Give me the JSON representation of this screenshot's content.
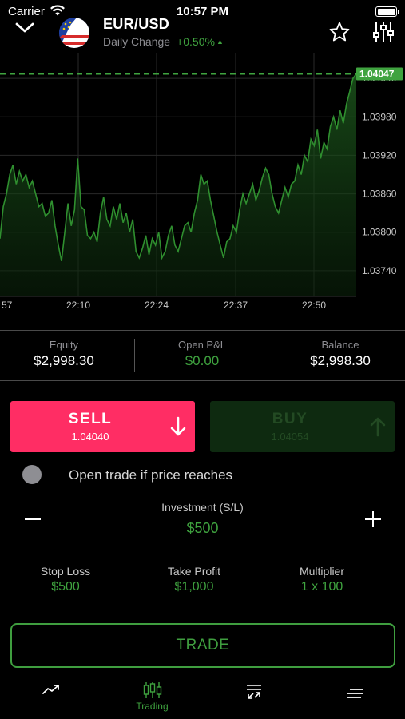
{
  "status_bar": {
    "carrier": "Carrier",
    "time": "10:57 PM"
  },
  "header": {
    "pair": "EUR/USD",
    "daily_change_label": "Daily Change",
    "daily_change_value": "+0.50%",
    "daily_change_arrow": "▲"
  },
  "chart_data": {
    "type": "area",
    "current_price_label": "1.04047",
    "current_price": 1.04047,
    "y_ticks": [
      "1.04040",
      "1.03980",
      "1.03920",
      "1.03860",
      "1.03800",
      "1.03740"
    ],
    "x_ticks": [
      "57",
      "22:10",
      "22:24",
      "22:37",
      "22:50"
    ],
    "ylim": [
      1.037,
      1.0408
    ],
    "grid": true,
    "line_color": "#2f8f2f",
    "series": [
      {
        "values": [
          1.0379,
          1.0384,
          1.0386,
          1.0389,
          1.03905,
          1.03875,
          1.03895,
          1.0388,
          1.0389,
          1.0387,
          1.0388,
          1.0386,
          1.0384,
          1.03845,
          1.03825,
          1.0383,
          1.0385,
          1.0381,
          1.0378,
          1.03755,
          1.038,
          1.03845,
          1.0381,
          1.03835,
          1.03915,
          1.0384,
          1.03835,
          1.03795,
          1.0379,
          1.038,
          1.03785,
          1.0383,
          1.03855,
          1.0382,
          1.0381,
          1.0384,
          1.0382,
          1.03845,
          1.03815,
          1.0383,
          1.038,
          1.0382,
          1.0377,
          1.0376,
          1.03775,
          1.03795,
          1.03765,
          1.0379,
          1.0378,
          1.038,
          1.0376,
          1.0377,
          1.03795,
          1.0381,
          1.0378,
          1.0377,
          1.0379,
          1.0381,
          1.03815,
          1.038,
          1.0383,
          1.0385,
          1.0389,
          1.03875,
          1.0388,
          1.0385,
          1.03825,
          1.038,
          1.0378,
          1.0376,
          1.03785,
          1.0379,
          1.0381,
          1.038,
          1.03835,
          1.0386,
          1.03845,
          1.0386,
          1.03875,
          1.0385,
          1.03865,
          1.03885,
          1.039,
          1.0389,
          1.0386,
          1.0384,
          1.0383,
          1.0385,
          1.0387,
          1.03855,
          1.03875,
          1.0388,
          1.03905,
          1.0389,
          1.0392,
          1.0391,
          1.03945,
          1.03935,
          1.0396,
          1.03915,
          1.0394,
          1.0393,
          1.03965,
          1.0398,
          1.0396,
          1.0399,
          1.0397,
          1.04,
          1.0402,
          1.0404,
          1.04047
        ]
      }
    ]
  },
  "stats": {
    "equity_label": "Equity",
    "equity_value": "$2,998.30",
    "open_pl_label": "Open P&L",
    "open_pl_value": "$0.00",
    "balance_label": "Balance",
    "balance_value": "$2,998.30"
  },
  "sell": {
    "label": "SELL",
    "price": "1.04040",
    "color": "#ff2d64"
  },
  "buy": {
    "label": "BUY",
    "price": "1.04054"
  },
  "open_trade_label": "Open trade if price reaches",
  "investment": {
    "label": "Investment (S/L)",
    "value": "$500"
  },
  "params": {
    "stop_loss_label": "Stop Loss",
    "stop_loss_value": "$500",
    "take_profit_label": "Take Profit",
    "take_profit_value": "$1,000",
    "multiplier_label": "Multiplier",
    "multiplier_value": "1 x 100"
  },
  "trade_button": "TRADE",
  "tabbar": {
    "items": [
      {
        "icon": "chart-line-icon",
        "label": ""
      },
      {
        "icon": "candlestick-icon",
        "label": "Trading"
      },
      {
        "icon": "positions-icon",
        "label": ""
      },
      {
        "icon": "menu-icon",
        "label": ""
      }
    ]
  },
  "colors": {
    "accent_green": "#3fa33f",
    "sell_red": "#ff2d64"
  }
}
